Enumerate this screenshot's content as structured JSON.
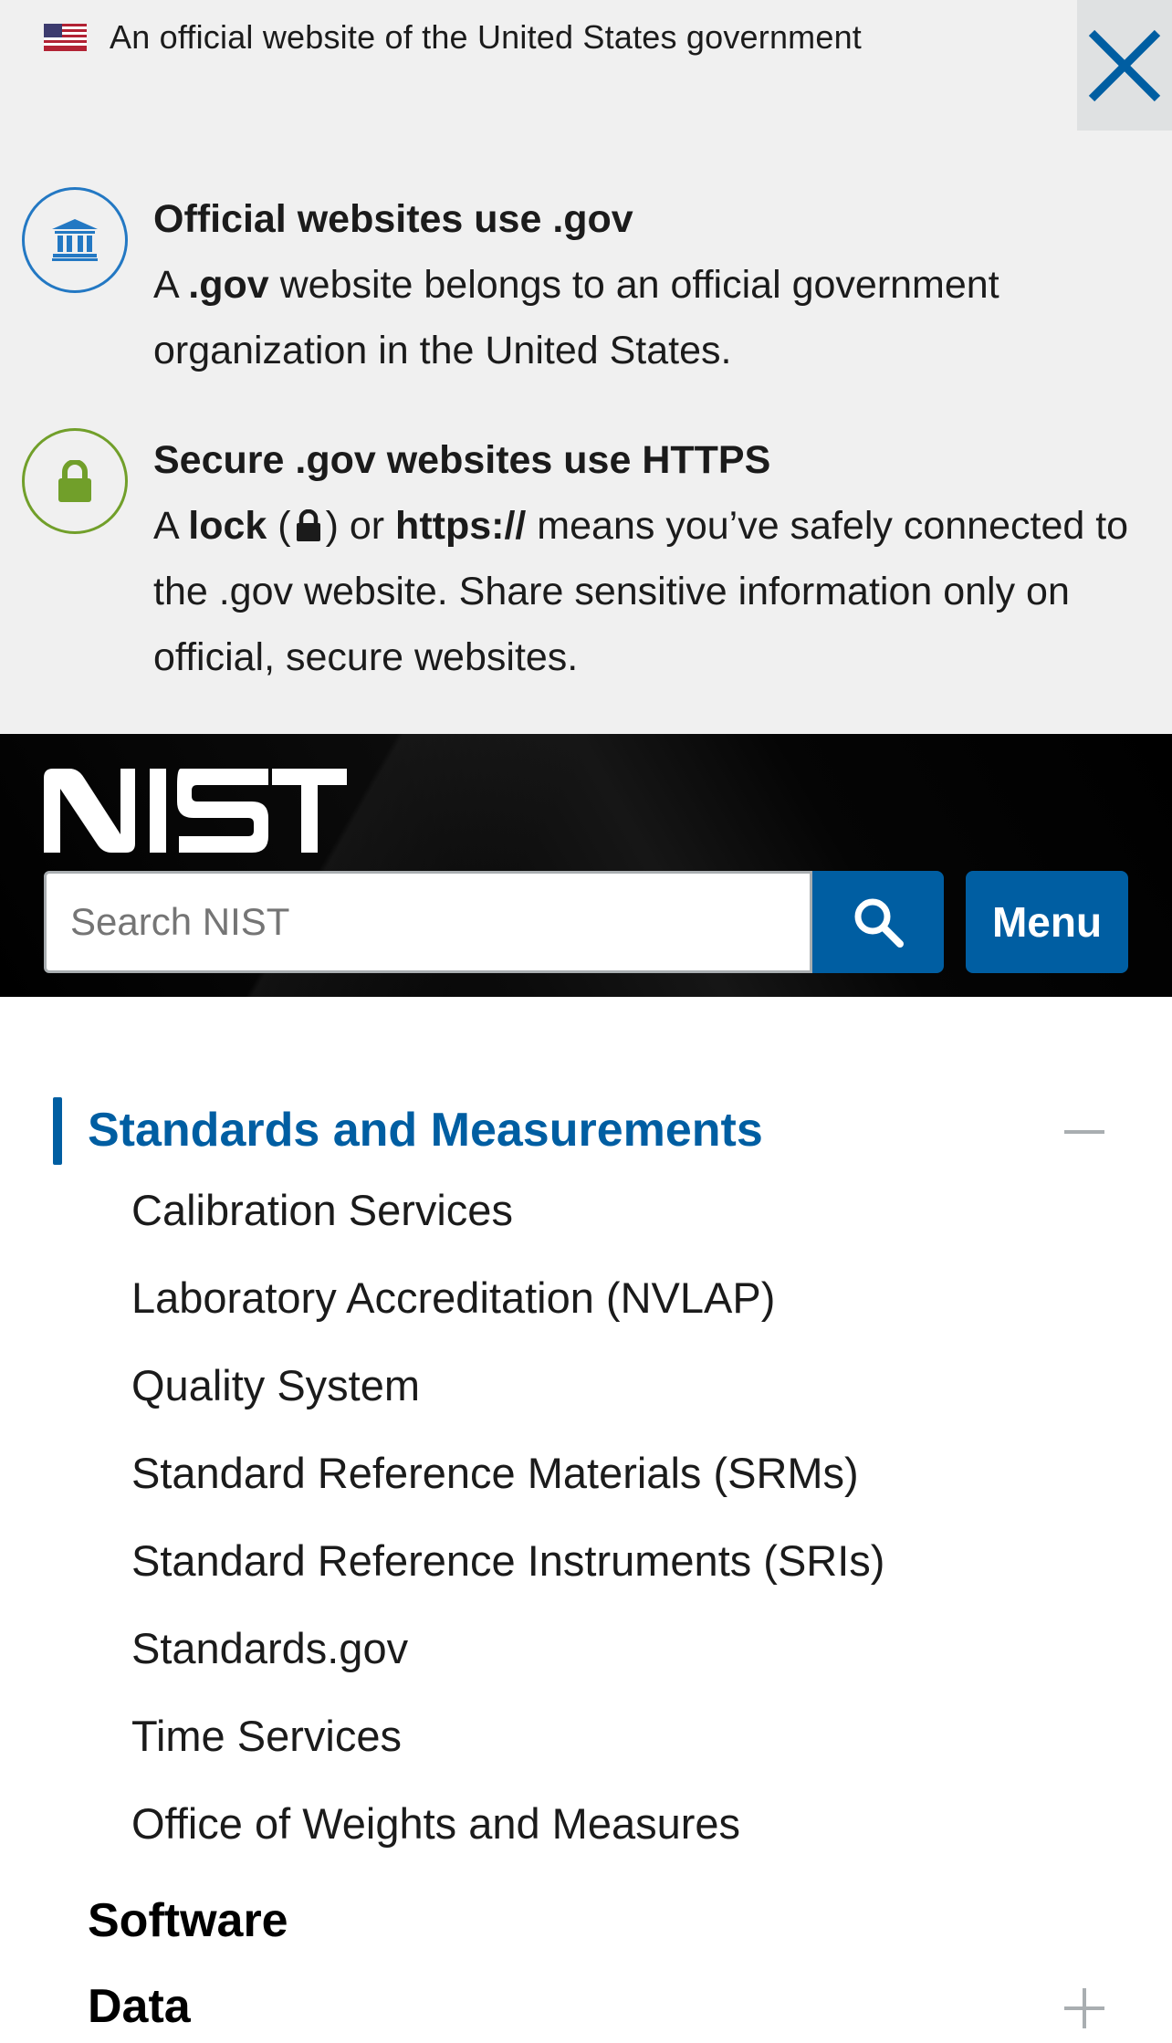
{
  "gov_banner": {
    "official_text": "An official website of the United States government",
    "dotgov": {
      "heading": "Official websites use .gov",
      "text_a": "A ",
      "text_bold": ".gov",
      "text_rest": " website belongs to an official government organization in the United States."
    },
    "https": {
      "heading": "Secure .gov websites use HTTPS",
      "text_a": "A ",
      "text_lock": "lock",
      "text_paren_open": " (",
      "text_paren_close": ") or ",
      "text_https": "https://",
      "text_rest": " means you’ve safely connected to the .gov website. Share sensitive information only on official, secure websites."
    },
    "icons": [
      "us-flag-icon",
      "close-icon",
      "bank-building-icon",
      "lock-icon"
    ]
  },
  "header": {
    "logo_text": "NIST",
    "search_placeholder": "Search NIST",
    "menu_label": "Menu",
    "colors": {
      "background": "#000000",
      "button": "#005ea2"
    }
  },
  "nav": {
    "active_section": "Standards and Measurements",
    "active_color": "#005ea2",
    "sub_items": [
      "Calibration Services",
      "Laboratory Accreditation (NVLAP)",
      "Quality System",
      "Standard Reference Materials (SRMs)",
      "Standard Reference Instruments (SRIs)",
      "Standards.gov",
      "Time Services",
      "Office of Weights and Measures"
    ],
    "software": "Software",
    "data": "Data"
  }
}
